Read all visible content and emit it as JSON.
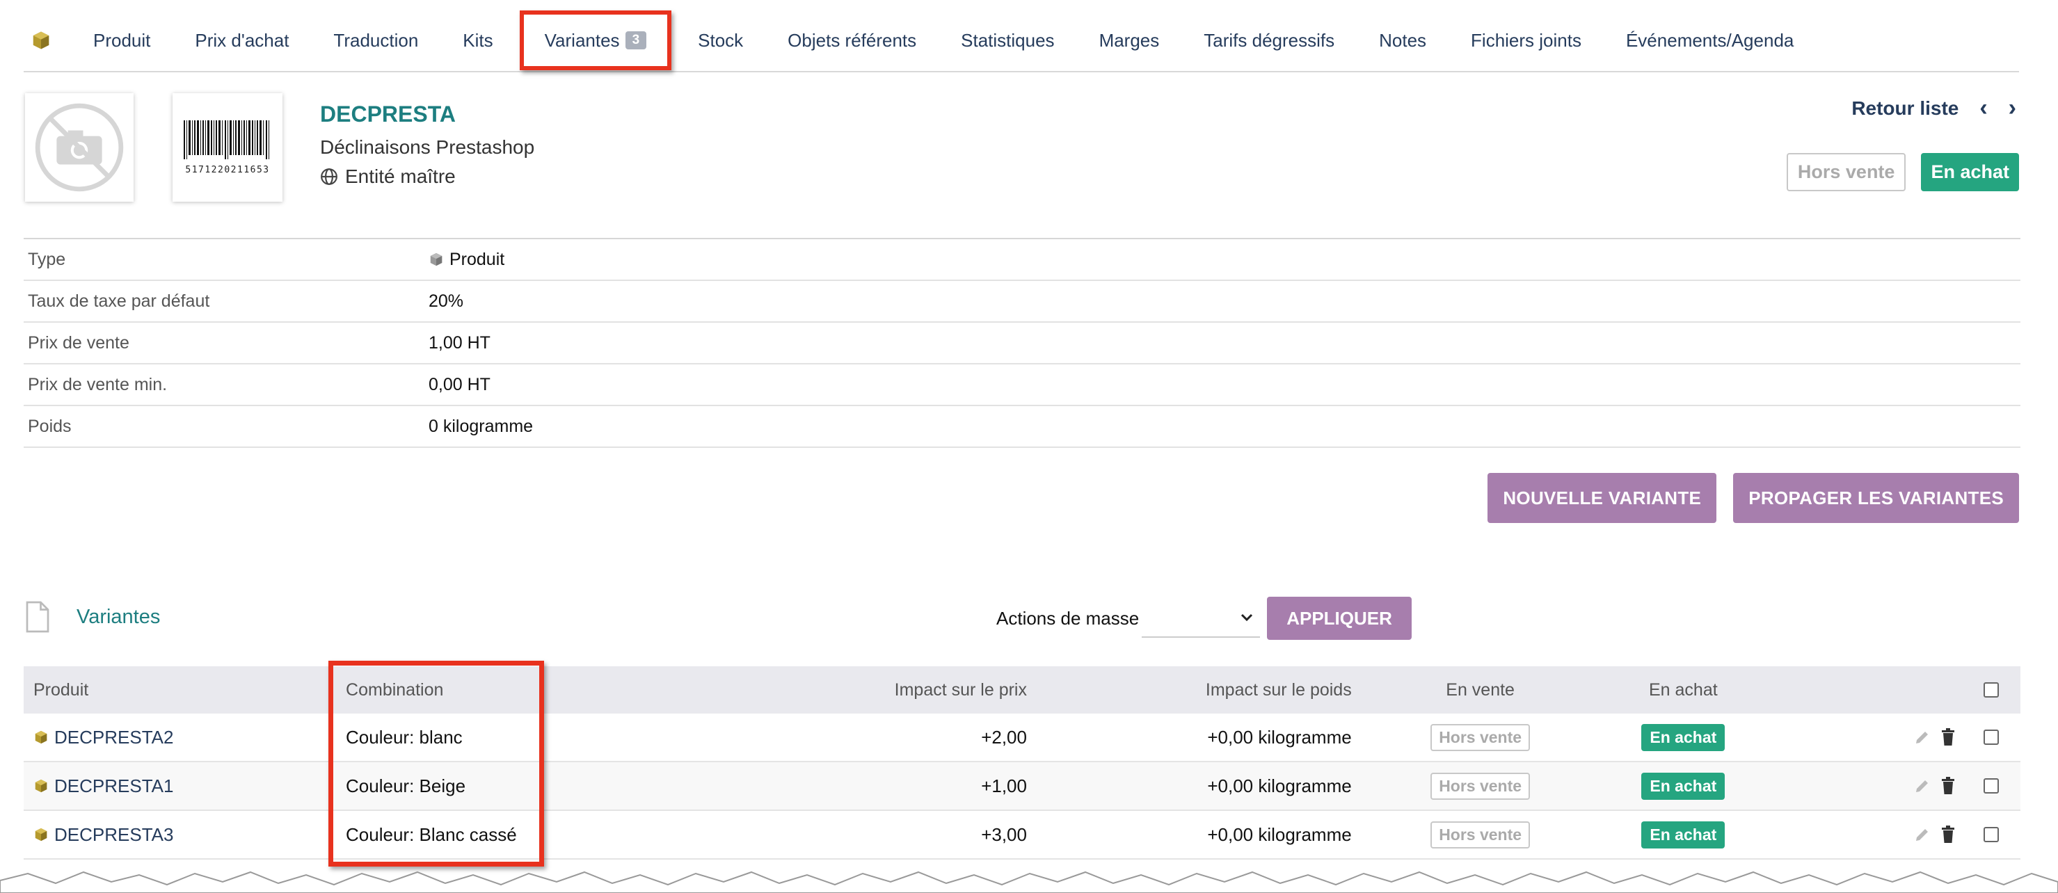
{
  "tabs": [
    {
      "label": "Produit"
    },
    {
      "label": "Prix d'achat"
    },
    {
      "label": "Traduction"
    },
    {
      "label": "Kits"
    },
    {
      "label": "Variantes",
      "badge": "3"
    },
    {
      "label": "Stock"
    },
    {
      "label": "Objets référents"
    },
    {
      "label": "Statistiques"
    },
    {
      "label": "Marges"
    },
    {
      "label": "Tarifs dégressifs"
    },
    {
      "label": "Notes"
    },
    {
      "label": "Fichiers joints"
    },
    {
      "label": "Événements/Agenda"
    }
  ],
  "header": {
    "ref": "DECPRESTA",
    "label": "Déclinaisons Prestashop",
    "entity": "Entité maître",
    "barcode_digits": "5171220211653",
    "retour": "Retour liste",
    "prev": "‹",
    "next": "›",
    "status_sale": "Hors vente",
    "status_buy": "En achat"
  },
  "info": [
    {
      "key": "Type",
      "value": "Produit"
    },
    {
      "key": "Taux de taxe par défaut",
      "value": "20%"
    },
    {
      "key": "Prix de vente",
      "value": "1,00 HT"
    },
    {
      "key": "Prix de vente min.",
      "value": "0,00 HT"
    },
    {
      "key": "Poids",
      "value": "0 kilogramme"
    }
  ],
  "actions": {
    "new_variant": "NOUVELLE VARIANTE",
    "propagate": "PROPAGER LES VARIANTES"
  },
  "variants_section": {
    "title": "Variantes",
    "mass_label": "Actions de masse",
    "mass_value": "",
    "apply": "APPLIQUER"
  },
  "grid": {
    "headers": {
      "product": "Produit",
      "combination": "Combination",
      "price_impact": "Impact sur le prix",
      "weight_impact": "Impact sur le poids",
      "on_sale": "En vente",
      "on_buy": "En achat"
    },
    "rows": [
      {
        "product": "DECPRESTA2",
        "combination": "Couleur: blanc",
        "price": "+2,00",
        "weight": "+0,00 kilogramme",
        "sale": "Hors vente",
        "buy": "En achat"
      },
      {
        "product": "DECPRESTA1",
        "combination": "Couleur: Beige",
        "price": "+1,00",
        "weight": "+0,00 kilogramme",
        "sale": "Hors vente",
        "buy": "En achat"
      },
      {
        "product": "DECPRESTA3",
        "combination": "Couleur: Blanc cassé",
        "price": "+3,00",
        "weight": "+0,00 kilogramme",
        "sale": "Hors vente",
        "buy": "En achat"
      }
    ]
  },
  "colors": {
    "accent_teal": "#1d7e80",
    "green": "#25a580",
    "purple": "#a77ead",
    "highlight_red": "#e8321e",
    "navy": "#263c5c"
  },
  "icons": {
    "module": "box-icon",
    "photo": "no-photo-icon",
    "globe": "globe-icon",
    "doc": "document-icon",
    "edit": "pencil-icon",
    "delete": "trash-icon"
  }
}
